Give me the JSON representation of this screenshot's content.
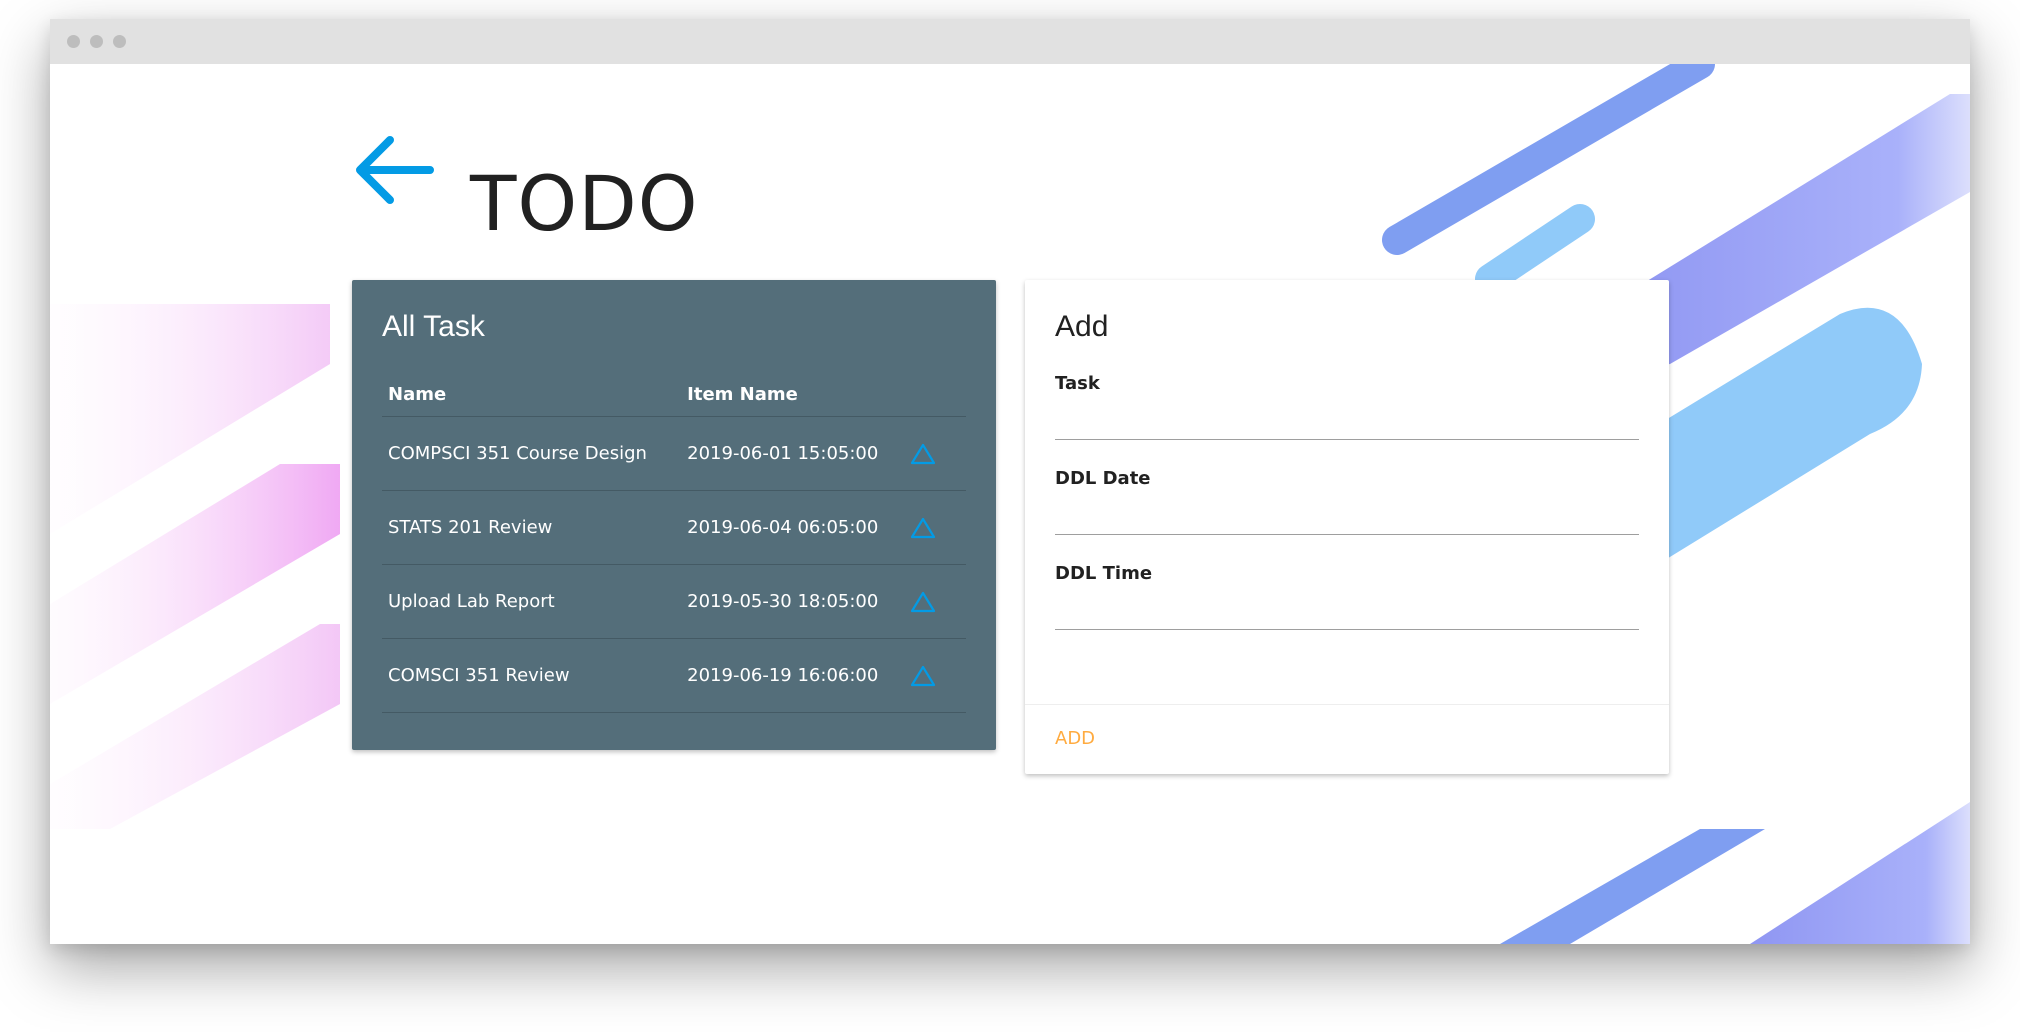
{
  "page": {
    "title": "TODO",
    "accent_color": "#039be5",
    "icon_back": "back-arrow-icon"
  },
  "tasks_card": {
    "title": "All Task",
    "background_color": "#546e7a",
    "columns": [
      "Name",
      "Item Name",
      ""
    ],
    "rows": [
      {
        "name": "COMPSCI 351 Course Design",
        "deadline": "2019-06-01 15:05:00",
        "action_icon": "triangle-up-icon"
      },
      {
        "name": "STATS 201 Review",
        "deadline": "2019-06-04 06:05:00",
        "action_icon": "triangle-up-icon"
      },
      {
        "name": "Upload Lab Report",
        "deadline": "2019-05-30 18:05:00",
        "action_icon": "triangle-up-icon"
      },
      {
        "name": "COMSCI 351 Review",
        "deadline": "2019-06-19 16:06:00",
        "action_icon": "triangle-up-icon"
      }
    ]
  },
  "add_card": {
    "title": "Add",
    "fields": [
      {
        "label": "Task",
        "value": ""
      },
      {
        "label": "DDL Date",
        "value": ""
      },
      {
        "label": "DDL Time",
        "value": ""
      }
    ],
    "action_label": "ADD",
    "action_color": "#ffab40"
  }
}
